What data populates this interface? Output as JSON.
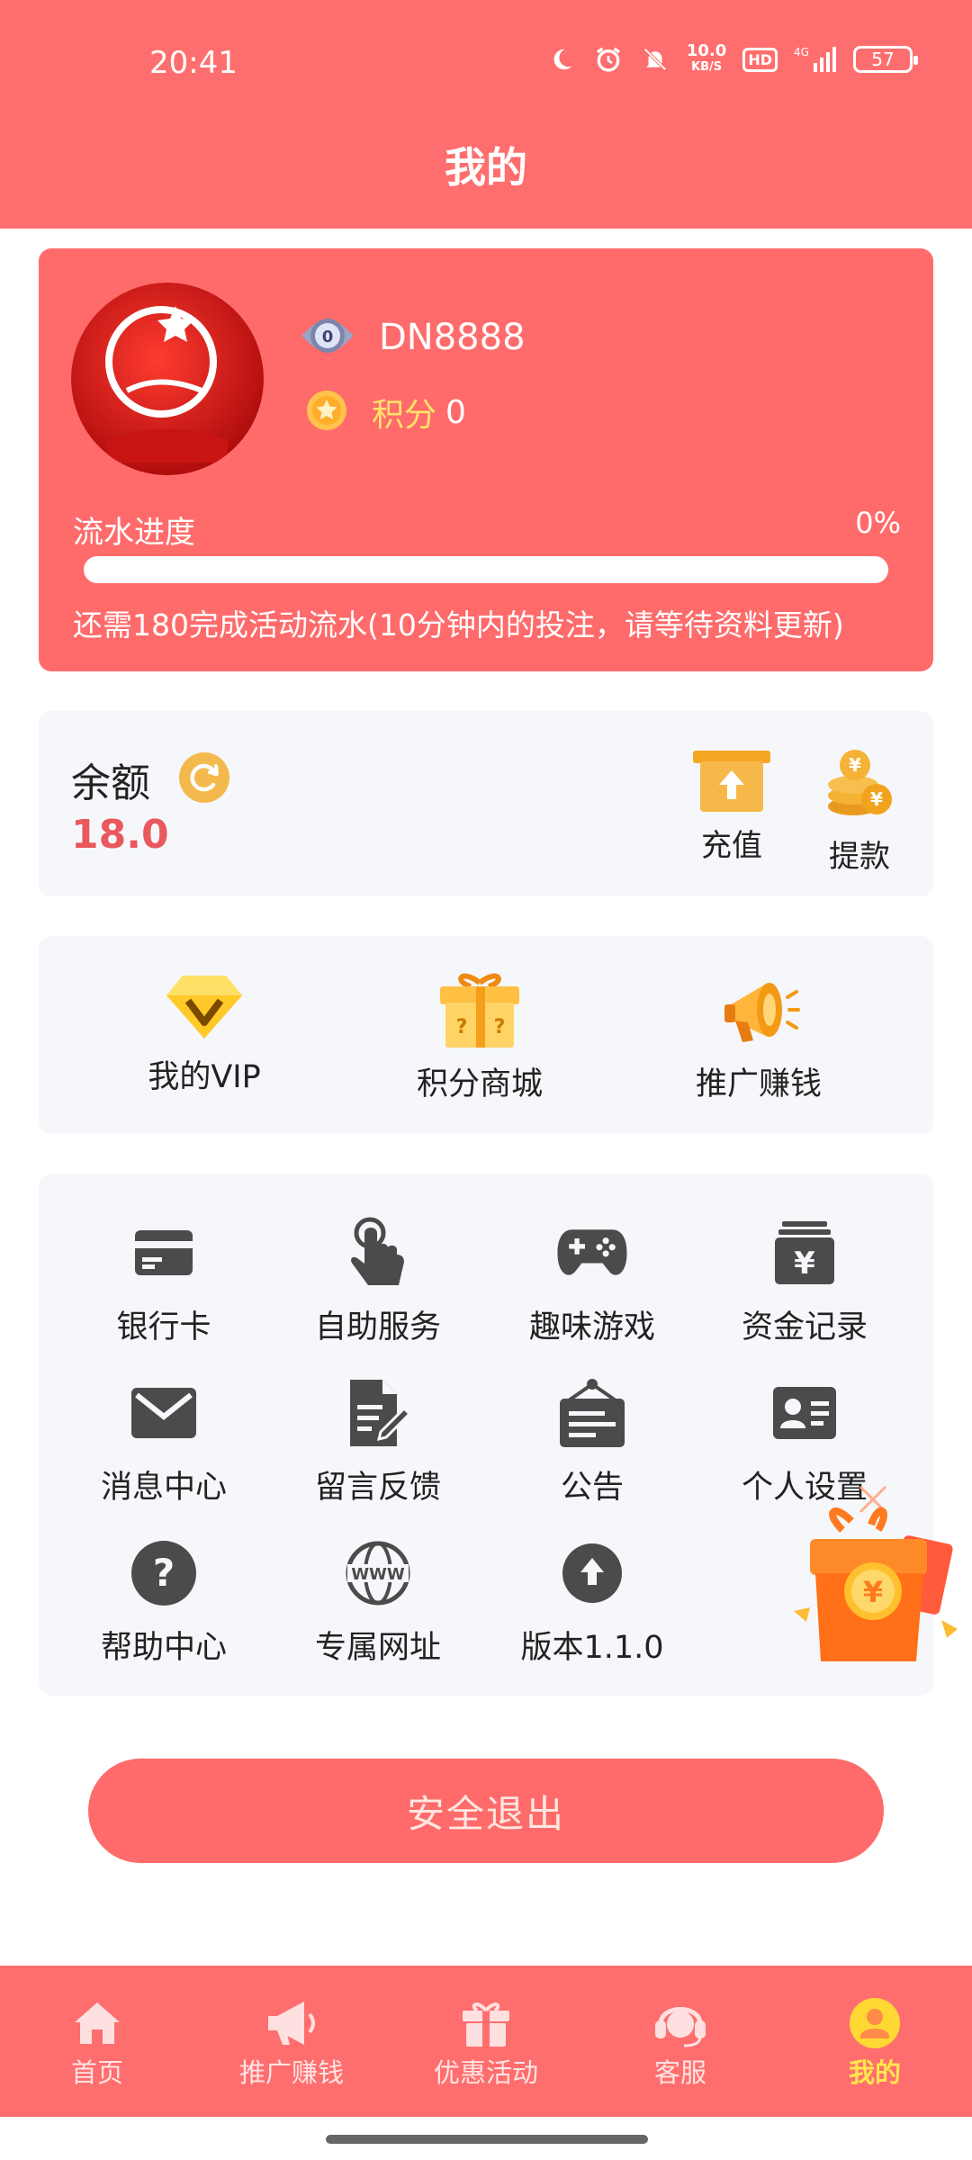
{
  "status_bar": {
    "time": "20:41",
    "net_speed_value": "10.0",
    "net_speed_unit": "KB/S",
    "hd": "HD",
    "network": "4G",
    "battery": "57"
  },
  "header": {
    "title": "我的"
  },
  "profile": {
    "vip_level": "0",
    "username": "DN8888",
    "points_label": "积分",
    "points_value": "0",
    "flow_label": "流水进度",
    "flow_percent": "0%",
    "flow_progress": 0,
    "flow_note": "还需180完成活动流水(10分钟内的投注，请等待资料更新)"
  },
  "balance": {
    "label": "余额",
    "value": "18.0",
    "recharge_label": "充值",
    "withdraw_label": "提款"
  },
  "features": [
    {
      "label": "我的VIP",
      "icon": "diamond-icon"
    },
    {
      "label": "积分商城",
      "icon": "gift-box-icon"
    },
    {
      "label": "推广赚钱",
      "icon": "megaphone-icon"
    }
  ],
  "menu": [
    {
      "label": "银行卡",
      "icon": "bank-card-icon"
    },
    {
      "label": "自助服务",
      "icon": "hand-pointer-icon"
    },
    {
      "label": "趣味游戏",
      "icon": "gamepad-icon"
    },
    {
      "label": "资金记录",
      "icon": "money-record-icon"
    },
    {
      "label": "消息中心",
      "icon": "mail-icon"
    },
    {
      "label": "留言反馈",
      "icon": "edit-document-icon"
    },
    {
      "label": "公告",
      "icon": "notice-board-icon"
    },
    {
      "label": "个人设置",
      "icon": "id-card-icon"
    },
    {
      "label": "帮助中心",
      "icon": "help-icon"
    },
    {
      "label": "专属网址",
      "icon": "www-icon"
    },
    {
      "label": "版本1.1.0",
      "icon": "upload-arrow-icon"
    }
  ],
  "logout": {
    "label": "安全退出"
  },
  "bottom_nav": [
    {
      "label": "首页",
      "icon": "home-icon"
    },
    {
      "label": "推广赚钱",
      "icon": "megaphone-icon"
    },
    {
      "label": "优惠活动",
      "icon": "gift-icon"
    },
    {
      "label": "客服",
      "icon": "headset-icon"
    },
    {
      "label": "我的",
      "icon": "user-icon",
      "active": true
    }
  ],
  "colors": {
    "primary": "#ff6e6e",
    "balance_value": "#e9585d",
    "points_label": "#ffe36a",
    "active_nav": "#ffe74c",
    "icon_gray": "#4b4b4b"
  }
}
